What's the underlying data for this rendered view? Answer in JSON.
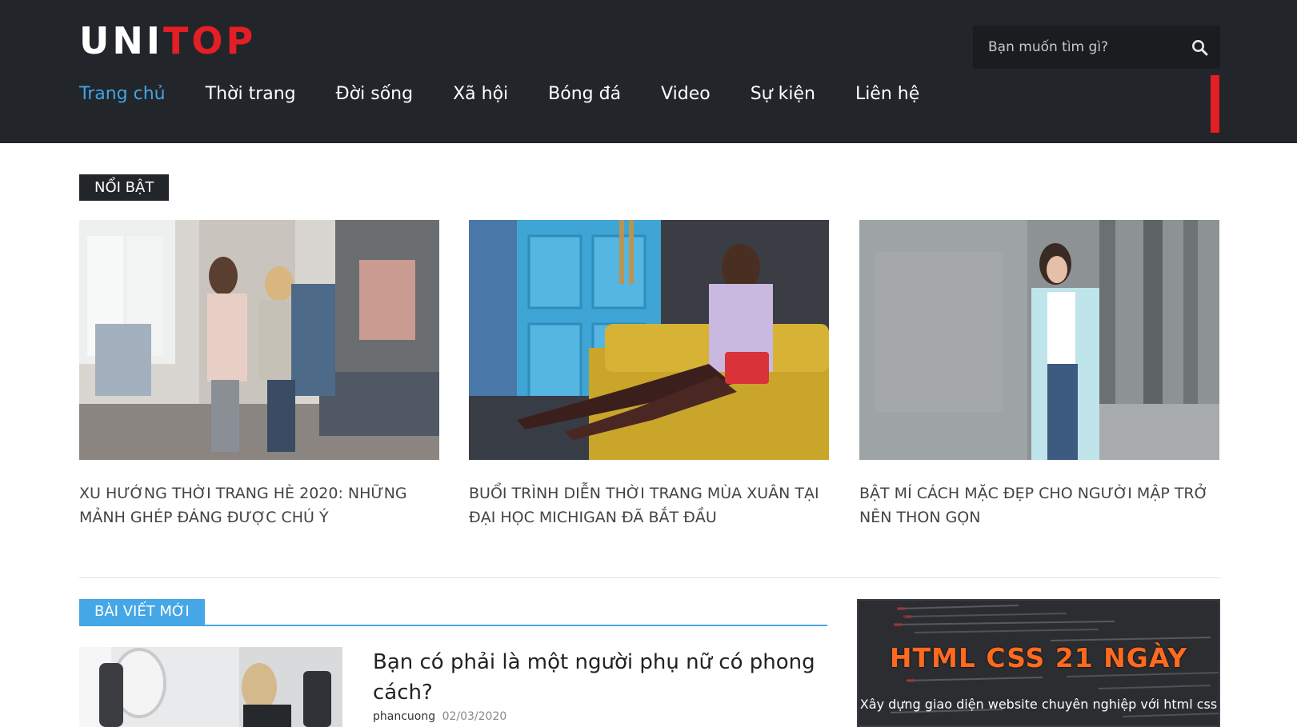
{
  "header": {
    "logo_part1": "UNI",
    "logo_part2": "TOP",
    "search_placeholder": "Bạn muốn tìm gì?",
    "nav": [
      "Trang chủ",
      "Thời trang",
      "Đời sống",
      "Xã hội",
      "Bóng đá",
      "Video",
      "Sự kiện",
      "Liên hệ"
    ],
    "active_nav": "Trang chủ"
  },
  "featured": {
    "label": "NỔI BẬT",
    "cards": [
      {
        "title": "XU HƯỚNG THỜI TRANG HÈ 2020: NHỮNG MẢNH GHÉP ĐÁNG ĐƯỢC CHÚ Ý"
      },
      {
        "title": "BUỔI TRÌNH DIỄN THỜI TRANG MÙA XUÂN TẠI ĐẠI HỌC MICHIGAN ĐÃ BẮT ĐẦU"
      },
      {
        "title": "BẬT MÍ CÁCH MẶC ĐẸP CHO NGƯỜI MẬP TRỞ NÊN THON GỌN"
      }
    ]
  },
  "latest": {
    "label": "BÀI VIẾT MỚI",
    "post": {
      "title": "Bạn có phải là một người phụ nữ có phong cách?",
      "author": "phancuong",
      "date": "02/03/2020"
    }
  },
  "ad": {
    "heading": "HTML CSS 21 NGÀY",
    "sub": "Xây dựng giao diện website chuyên nghiệp với html css"
  },
  "colors": {
    "header_bg": "#222529",
    "accent_red": "#e31e24",
    "accent_blue": "#45a7e6",
    "ad_orange": "#ff6a1f"
  }
}
